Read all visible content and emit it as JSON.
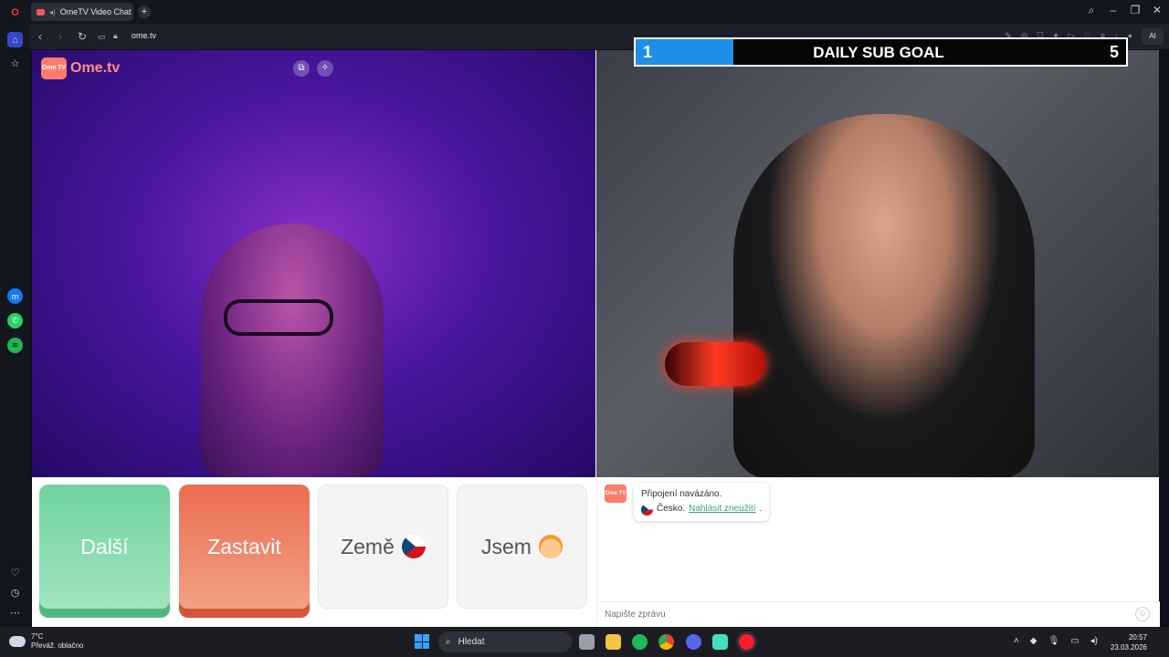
{
  "browser": {
    "tab_title": "OmeTV Video Chat -",
    "new_tab": "+",
    "url": "ome.tv",
    "ai_label": "AI"
  },
  "cam": {
    "logo_badge": "Ome TV",
    "logo_text": "Ome.tv"
  },
  "goal": {
    "current": "1",
    "title": "DAILY SUB GOAL",
    "target": "5",
    "progress_fraction": 0.2,
    "fill_color": "#1e8fe8"
  },
  "controls": {
    "next_label": "Další",
    "stop_label": "Zastavit",
    "country_label": "Země",
    "gender_label": "Jsem",
    "next_color": "#6fd3a0",
    "stop_color": "#ea6d51"
  },
  "chat": {
    "badge": "Ome TV",
    "status": "Připojení navázáno.",
    "country": "Česko.",
    "report_link": "Nahlásit zneužití",
    "input_placeholder": "Napište zprávu"
  },
  "taskbar": {
    "temp": "7°C",
    "weather": "Převáž. oblačno",
    "search": "Hledat",
    "time": "20:57",
    "date": "23.03.2026"
  }
}
